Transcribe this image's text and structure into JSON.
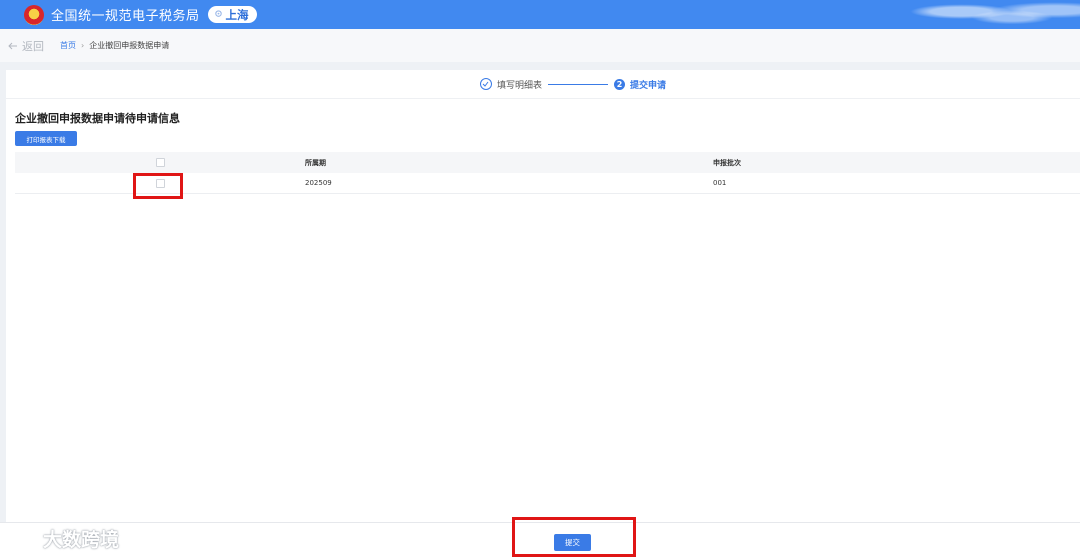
{
  "header": {
    "site_title": "全国统一规范电子税务局",
    "region": "上海"
  },
  "breadcrumb": {
    "back_label": "返回",
    "home": "首页",
    "separator": "›",
    "current": "企业撤回申报数据申请"
  },
  "steps": [
    {
      "label": "填写明细表",
      "state": "done"
    },
    {
      "number": "2",
      "label": "提交申请",
      "state": "active"
    }
  ],
  "section": {
    "title": "企业撤回申报数据申请待申请信息",
    "print_button": "打印报表下载"
  },
  "table": {
    "columns": [
      "所属期",
      "申报批次"
    ],
    "rows": [
      {
        "period": "202509",
        "batch": "001"
      }
    ]
  },
  "footer": {
    "submit_label": "提交"
  },
  "watermark": {
    "text": "大数跨境"
  },
  "colors": {
    "header_blue": "#4189f0",
    "primary": "#3a7be6",
    "highlight": "#e01515"
  }
}
